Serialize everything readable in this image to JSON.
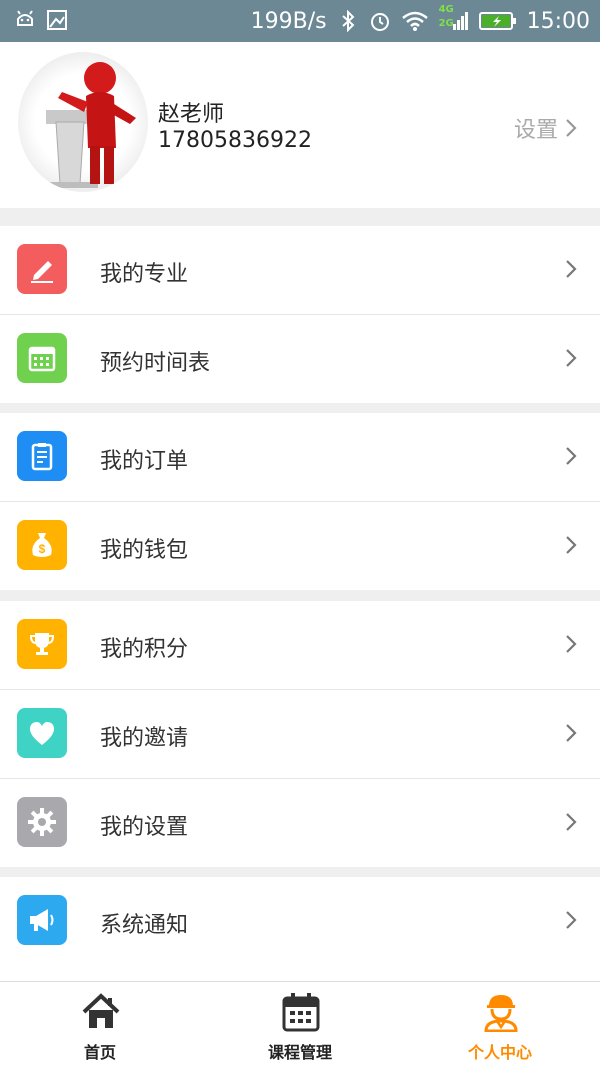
{
  "status_bar": {
    "net_speed": "199B/s",
    "time": "15:00",
    "signal_4g": "4G",
    "signal_2g": "2G"
  },
  "profile": {
    "name": "赵老师",
    "phone": "17805836922",
    "settings_label": "设置"
  },
  "menu_groups": [
    [
      {
        "label": "我的专业",
        "icon": "pencil-icon",
        "color": "#f45d5d"
      },
      {
        "label": "预约时间表",
        "icon": "calendar-icon",
        "color": "#6fd14d"
      }
    ],
    [
      {
        "label": "我的订单",
        "icon": "clipboard-icon",
        "color": "#1e8ef5"
      },
      {
        "label": "我的钱包",
        "icon": "money-bag-icon",
        "color": "#ffb300"
      }
    ],
    [
      {
        "label": "我的积分",
        "icon": "trophy-icon",
        "color": "#ffb300"
      },
      {
        "label": "我的邀请",
        "icon": "heart-icon",
        "color": "#3fd3c5"
      },
      {
        "label": "我的设置",
        "icon": "gear-icon",
        "color": "#a8a8ad"
      }
    ],
    [
      {
        "label": "系统通知",
        "icon": "megaphone-icon",
        "color": "#2ca9ef"
      }
    ]
  ],
  "tabs": [
    {
      "label": "首页",
      "icon": "home-icon",
      "active": false
    },
    {
      "label": "课程管理",
      "icon": "calendar-icon",
      "active": false
    },
    {
      "label": "个人中心",
      "icon": "worker-icon",
      "active": true
    }
  ],
  "colors": {
    "accent": "#ff8a00",
    "status_bar": "#6b8894"
  }
}
